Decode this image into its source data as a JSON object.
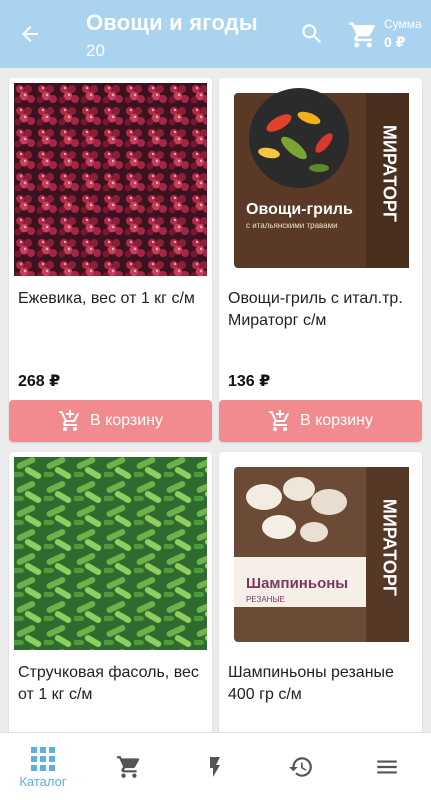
{
  "header": {
    "title": "Овощи и ягоды",
    "count": "20",
    "cart_sum_label": "Сумма",
    "cart_sum_value": "0 ₽"
  },
  "products": [
    {
      "name": "Ежевика, вес от 1 кг с/м",
      "price": "268 ₽",
      "button": "В корзину"
    },
    {
      "name": "Овощи-гриль с итал.тр. Мираторг с/м",
      "price": "136 ₽",
      "button": "В корзину",
      "package_brand": "МИРАТОРГ",
      "package_title": "Овощи-гриль",
      "package_sub": "с итальянскими травами"
    },
    {
      "name": "Стручковая фасоль, вес от 1 кг  с/м",
      "price": "",
      "button": ""
    },
    {
      "name": "Шампиньоны резаные 400 гр  с/м",
      "price": "",
      "button": "",
      "package_brand": "МИРАТОРГ",
      "package_title": "Шампиньоны",
      "package_sub": "РЕЗАНЫЕ"
    }
  ],
  "bottom_nav": {
    "catalog_label": "Каталог"
  },
  "colors": {
    "appbar": "#a9d3ee",
    "buy_button": "#f28b8f",
    "nav_active": "#5fb0e0"
  }
}
